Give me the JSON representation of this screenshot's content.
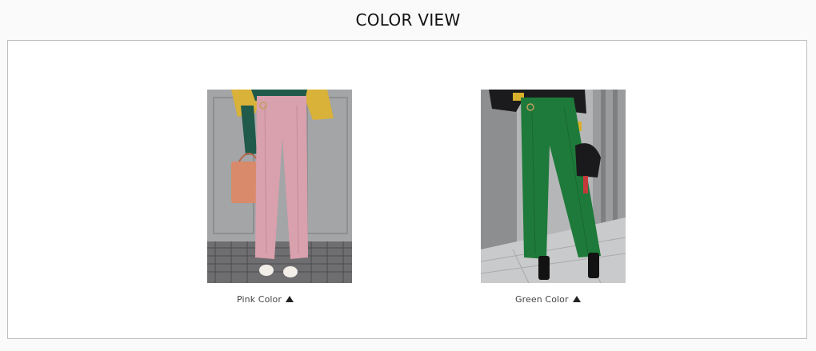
{
  "header": {
    "title": "COLOR VIEW"
  },
  "products": [
    {
      "caption": "Pink Color",
      "arrow_icon": "triangle-up-icon",
      "pants_color": "#d9a0ad",
      "image_name": "pink-pants-photo"
    },
    {
      "caption": "Green Color",
      "arrow_icon": "triangle-up-icon",
      "pants_color": "#1e7a3a",
      "image_name": "green-pants-photo"
    }
  ]
}
